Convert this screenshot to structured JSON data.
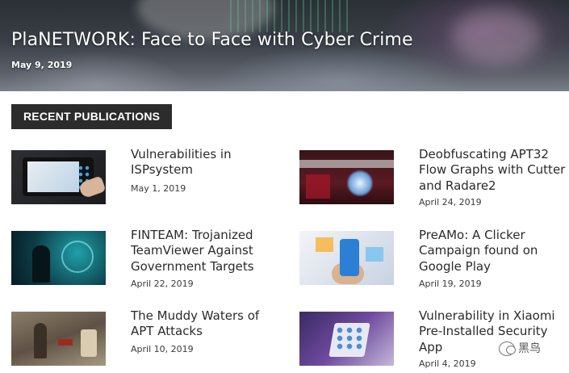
{
  "hero": {
    "title": "PlaNETWORK: Face to Face with Cyber Crime",
    "date": "May 9, 2019"
  },
  "section": {
    "label": "RECENT PUBLICATIONS"
  },
  "publications": [
    {
      "title": "Vulnerabilities in ISPsystem",
      "date": "May 1, 2019",
      "image": "tablet-touch-thumbnail"
    },
    {
      "title": "Deobfuscating APT32 Flow Graphs with Cutter and Radare2",
      "date": "April 24, 2019",
      "image": "network-orb-thumbnail"
    },
    {
      "title": "FINTEAM: Trojanized TeamViewer Against Government Targets",
      "date": "April 22, 2019",
      "image": "hooded-figure-thumbnail"
    },
    {
      "title": "PreAMo: A Clicker Campaign found on Google Play",
      "date": "April 19, 2019",
      "image": "smartphone-apps-thumbnail"
    },
    {
      "title": "The Muddy Waters of APT Attacks",
      "date": "April 10, 2019",
      "image": "muddy-ground-thumbnail"
    },
    {
      "title": "Vulnerability in Xiaomi Pre-Installed Security App",
      "date": "April 4, 2019",
      "image": "xiaomi-phone-thumbnail"
    }
  ],
  "watermark": {
    "text": "黑鸟",
    "icon": "wechat-icon"
  }
}
